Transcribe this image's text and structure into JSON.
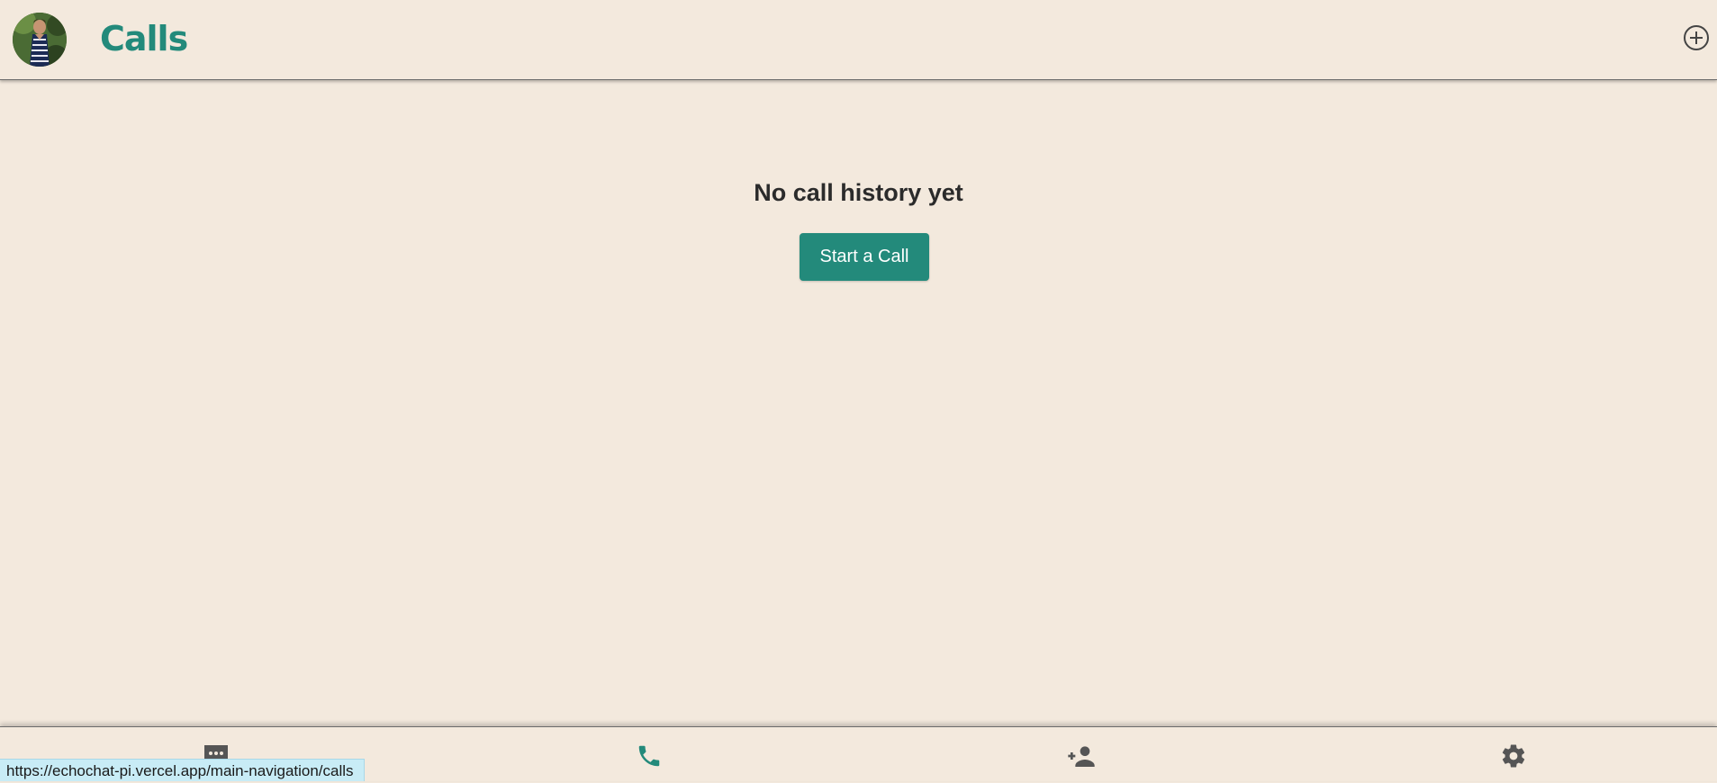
{
  "header": {
    "title": "Calls",
    "avatar_icon": "user-avatar-photo",
    "add_icon": "add-circle-icon"
  },
  "main": {
    "empty_heading": "No call history yet",
    "start_button_label": "Start a Call"
  },
  "bottom_nav": {
    "items": [
      {
        "id": "chats",
        "icon": "chat-bubble-icon",
        "active": false
      },
      {
        "id": "calls",
        "icon": "phone-icon",
        "active": true
      },
      {
        "id": "add-contact",
        "icon": "person-add-icon",
        "active": false
      },
      {
        "id": "settings",
        "icon": "gear-icon",
        "active": false
      }
    ]
  },
  "status_bar": {
    "url": "https://echochat-pi.vercel.app/main-navigation/calls"
  },
  "colors": {
    "background": "#f3e9dd",
    "accent": "#238a7b",
    "icon_gray": "#555555",
    "text_dark": "#2b2b2b",
    "status_bar_bg": "#c8ecf6"
  }
}
